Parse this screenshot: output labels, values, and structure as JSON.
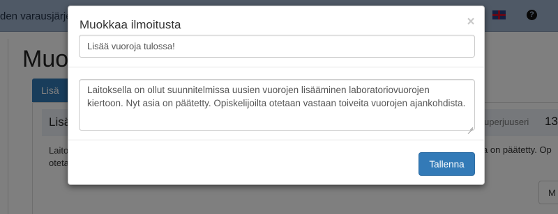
{
  "background": {
    "navbar": {
      "brand_text": "den varausjärje",
      "language_flag_icon": "uk-flag-icon",
      "help_icon": "question-circle-icon",
      "help_glyph": "?"
    },
    "page_heading": "Muok",
    "tab_label": "Lisä",
    "panel": {
      "title": "Lisä",
      "superuser_label": "uperjuuseri",
      "count": "13",
      "body_line1": "Laitok",
      "body_line2": "otetaa",
      "body_right": "a on päätetty. Op",
      "button_label": "M"
    }
  },
  "modal": {
    "title": "Muokkaa ilmoitusta",
    "close_label": "×",
    "title_input_value": "Lisää vuoroja tulossa!",
    "body_textarea_value": "Laitoksella on ollut suunnitelmissa uusien vuorojen lisääminen laboratoriovuorojen kiertoon. Nyt asia on päätetty. Opiskelijoilta otetaan vastaan toiveita vuorojen ajankohdista.",
    "save_label": "Tallenna"
  },
  "colors": {
    "primary": "#337ab7",
    "navbar": "#9fb2cc",
    "backdrop": "rgba(0,0,0,0.5)"
  }
}
